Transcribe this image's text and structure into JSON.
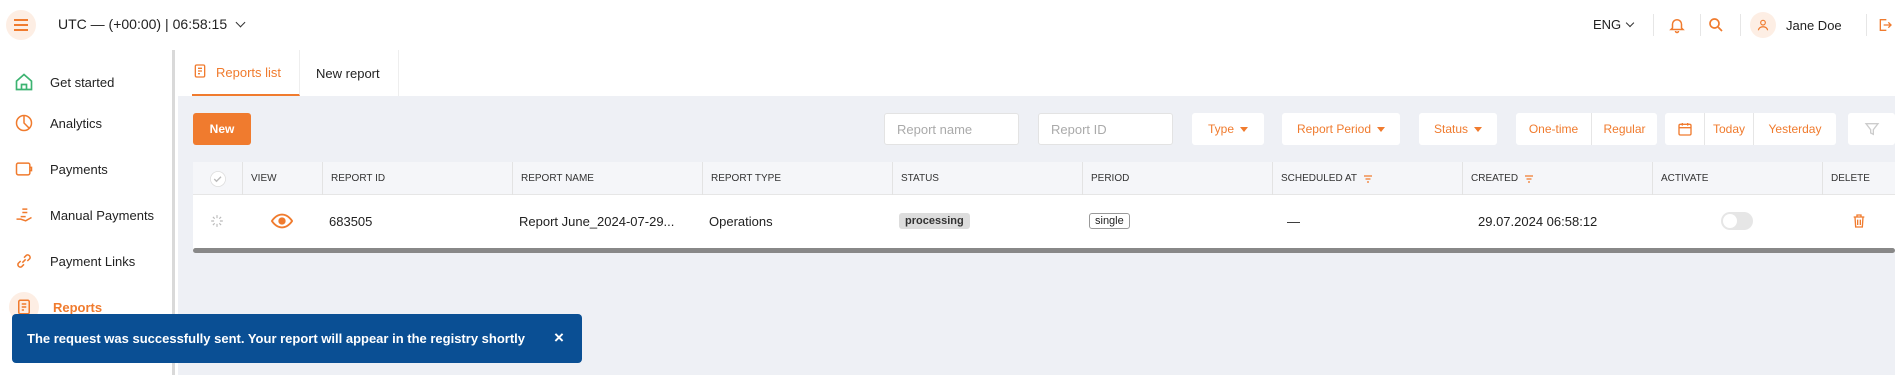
{
  "header": {
    "timezone": "UTC — (+00:00) |",
    "time": "06:58:15",
    "language": "ENG",
    "user_name": "Jane Doe"
  },
  "sidebar": {
    "items": [
      {
        "label": "Get started",
        "icon": "home-icon"
      },
      {
        "label": "Analytics",
        "icon": "pie-chart-icon"
      },
      {
        "label": "Payments",
        "icon": "wallet-icon"
      },
      {
        "label": "Manual Payments",
        "icon": "hand-coins-icon"
      },
      {
        "label": "Payment Links",
        "icon": "link-icon"
      },
      {
        "label": "Reports",
        "icon": "report-icon",
        "active": true
      }
    ]
  },
  "tabs": [
    {
      "label": "Reports list",
      "active": true
    },
    {
      "label": "New report",
      "active": false
    }
  ],
  "filters": {
    "new_label": "New",
    "report_name_placeholder": "Report name",
    "report_id_placeholder": "Report ID",
    "type_label": "Type",
    "report_period_label": "Report Period",
    "status_label": "Status",
    "one_time_label": "One-time",
    "regular_label": "Regular",
    "today_label": "Today",
    "yesterday_label": "Yesterday"
  },
  "table": {
    "columns": [
      "VIEW",
      "REPORT ID",
      "REPORT NAME",
      "REPORT TYPE",
      "STATUS",
      "PERIOD",
      "SCHEDULED AT",
      "CREATED",
      "ACTIVATE",
      "DELETE"
    ],
    "rows": [
      {
        "report_id": "683505",
        "report_name": "Report June_2024-07-29...",
        "report_type": "Operations",
        "status": "processing",
        "period": "single",
        "scheduled_at": "—",
        "created": "29.07.2024 06:58:12"
      }
    ]
  },
  "toast": {
    "message": "The request was successfully sent. Your report will appear in the registry shortly",
    "close": "×"
  },
  "colors": {
    "accent": "#f07b2e",
    "toast_bg": "#0a4f94",
    "success_green": "#3cb371"
  }
}
